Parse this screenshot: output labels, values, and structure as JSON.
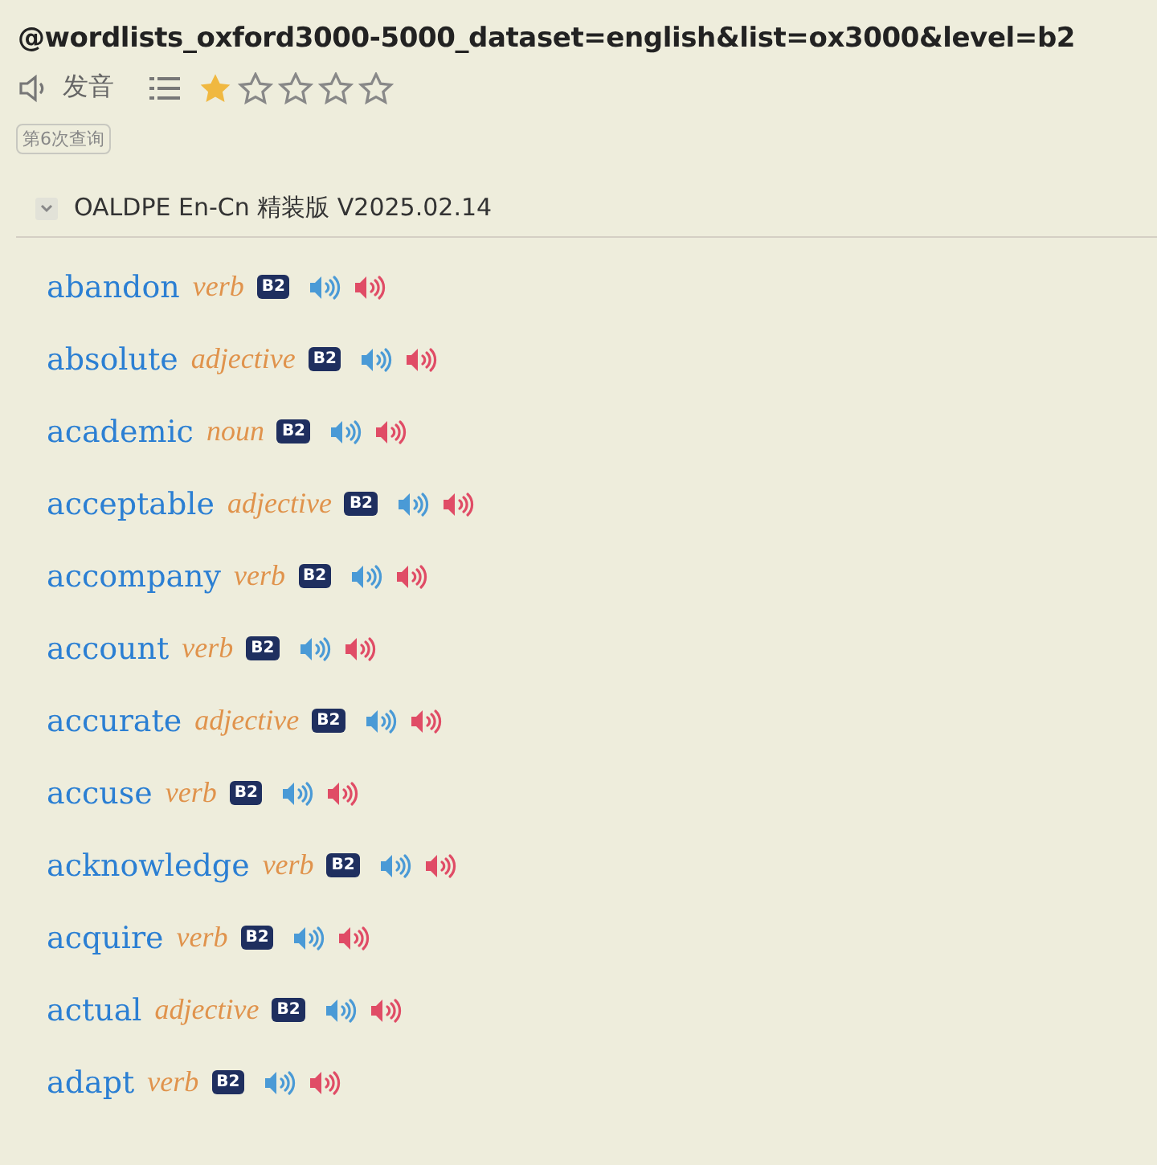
{
  "title": "@wordlists_oxford3000-5000_dataset=english&list=ox3000&level=b2",
  "toolbar": {
    "pronounce_label": "发音",
    "stars": 1
  },
  "query_badge": "第6次查询",
  "dictionary": {
    "name": "OALDPE En-Cn 精装版 V2025.02.14",
    "expanded": true
  },
  "entries": [
    {
      "word": "abandon",
      "pos": "verb",
      "level": "B2"
    },
    {
      "word": "absolute",
      "pos": "adjective",
      "level": "B2"
    },
    {
      "word": "academic",
      "pos": "noun",
      "level": "B2"
    },
    {
      "word": "acceptable",
      "pos": "adjective",
      "level": "B2"
    },
    {
      "word": "accompany",
      "pos": "verb",
      "level": "B2"
    },
    {
      "word": "account",
      "pos": "verb",
      "level": "B2"
    },
    {
      "word": "accurate",
      "pos": "adjective",
      "level": "B2"
    },
    {
      "word": "accuse",
      "pos": "verb",
      "level": "B2"
    },
    {
      "word": "acknowledge",
      "pos": "verb",
      "level": "B2"
    },
    {
      "word": "acquire",
      "pos": "verb",
      "level": "B2"
    },
    {
      "word": "actual",
      "pos": "adjective",
      "level": "B2"
    },
    {
      "word": "adapt",
      "pos": "verb",
      "level": "B2"
    }
  ]
}
